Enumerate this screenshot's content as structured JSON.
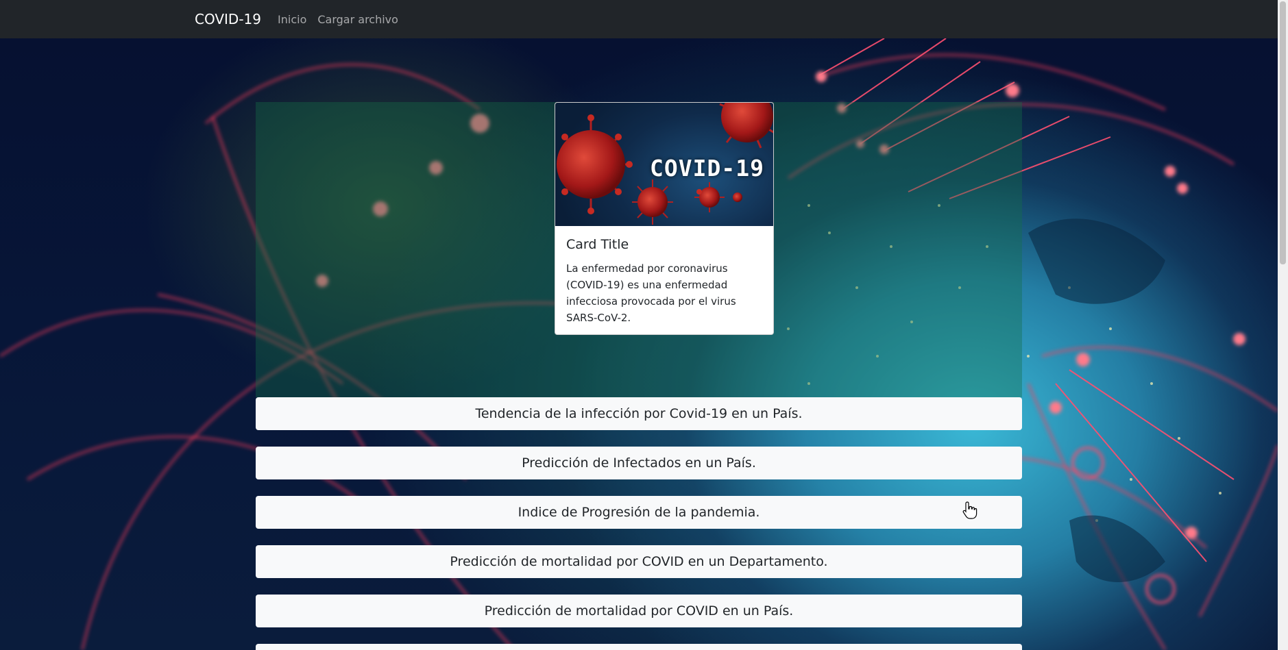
{
  "navbar": {
    "brand": "COVID-19",
    "links": [
      "Inicio",
      "Cargar archivo"
    ]
  },
  "card": {
    "image_text": "COVID-19",
    "title": "Card Title",
    "text": "La enfermedad por coronavirus (COVID-19) es una enfermedad infecciosa provocada por el virus SARS-CoV-2."
  },
  "options": [
    "Tendencia de la infección por Covid-19 en un País.",
    "Predicción de Infectados en un País.",
    "Indice de Progresión de la pandemia.",
    "Predicción de mortalidad por COVID en un Departamento.",
    "Predicción de mortalidad por COVID en un País."
  ],
  "colors": {
    "navbar": "#212529",
    "list_item_bg": "#f8f9fa",
    "hero_overlay": "#146e46"
  }
}
